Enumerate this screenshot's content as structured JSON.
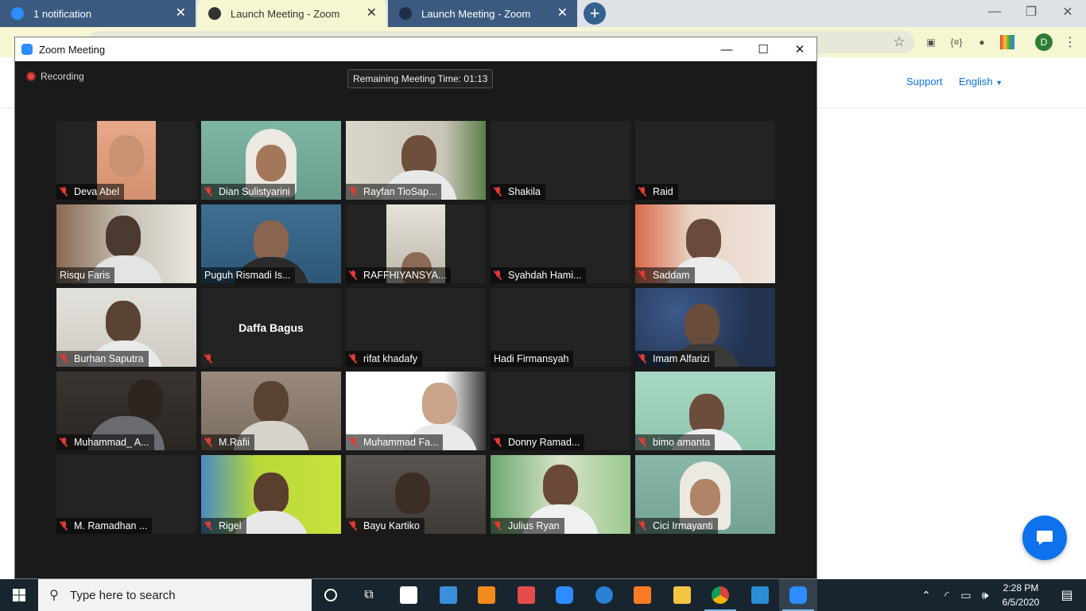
{
  "browser": {
    "tabs": [
      {
        "title": "1 notification"
      },
      {
        "title": "Launch Meeting - Zoom"
      },
      {
        "title": "Launch Meeting - Zoom"
      }
    ],
    "profile_initial": "D"
  },
  "page": {
    "support_label": "Support",
    "language_label": "English"
  },
  "zoom": {
    "window_title": "Zoom Meeting",
    "recording_label": "Recording",
    "timer_text": "Remaining Meeting Time: 01:13",
    "participants": [
      {
        "name": "Deva Abel",
        "muted": true
      },
      {
        "name": "Dian Sulistyarini",
        "muted": true
      },
      {
        "name": "Rayfan TioSap...",
        "muted": true
      },
      {
        "name": "Shakila",
        "muted": true
      },
      {
        "name": "Raid",
        "muted": true
      },
      {
        "name": "Risqu Faris",
        "muted": false
      },
      {
        "name": "Puguh Rismadi Is...",
        "muted": false,
        "active_speaker": true
      },
      {
        "name": "RAFFHIYANSYA...",
        "muted": true
      },
      {
        "name": "Syahdah Hami...",
        "muted": true
      },
      {
        "name": "Saddam",
        "muted": true
      },
      {
        "name": "Burhan Saputra",
        "muted": true
      },
      {
        "name": "",
        "display_name": "Daffa Bagus",
        "muted": true
      },
      {
        "name": "rifat khadafy",
        "muted": true
      },
      {
        "name": "Hadi Firmansyah",
        "muted": false
      },
      {
        "name": "Imam Alfarizi",
        "muted": true
      },
      {
        "name": "Muhammad_ A...",
        "muted": true
      },
      {
        "name": "M.Rafii",
        "muted": true
      },
      {
        "name": "Muhammad Fa...",
        "muted": true
      },
      {
        "name": "Donny Ramad...",
        "muted": true
      },
      {
        "name": "bimo amanta",
        "muted": true
      },
      {
        "name": "M. Ramadhan ...",
        "muted": true
      },
      {
        "name": "Rigel",
        "muted": true
      },
      {
        "name": "Bayu Kartiko",
        "muted": true
      },
      {
        "name": "Julius Ryan",
        "muted": true
      },
      {
        "name": "Cici Irmayanti",
        "muted": true
      }
    ]
  },
  "taskbar": {
    "search_placeholder": "Type here to search",
    "time": "2:28 PM",
    "date": "6/5/2020"
  },
  "colors": {
    "zoom_blue": "#2d8cff",
    "link_blue": "#0e72ed",
    "muted_red": "#e23b33",
    "speaker_outline": "#e5e88f"
  }
}
